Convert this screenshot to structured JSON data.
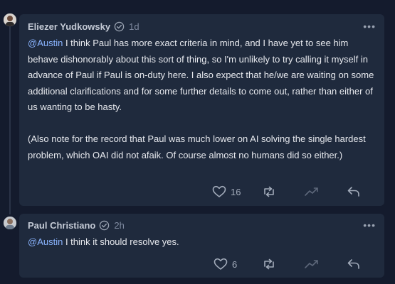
{
  "comments": [
    {
      "author": "Eliezer Yudkowsky",
      "time": "1d",
      "more": "•••",
      "mention": "@Austin",
      "paragraph1": " I think Paul has more exact criteria in mind, and I have yet to see him behave dishonorably about this sort of thing, so I'm unlikely to try calling it myself in advance of Paul if Paul is on-duty here.  I also expect that he/we are waiting on some additional clarifications and for some further details to come out, rather than either of us wanting to be hasty.",
      "paragraph2": "(Also note for the record that Paul was much lower on AI solving the single hardest problem, which OAI did not afaik.  Of course almost no humans did so either.)",
      "likes": "16",
      "icons": [
        "avatar",
        "verified-icon",
        "more-icon",
        "heart-icon",
        "repost-icon",
        "trend-icon",
        "reply-icon"
      ]
    },
    {
      "author": "Paul Christiano",
      "time": "2h",
      "more": "•••",
      "mention": "@Austin",
      "text": " I think it should resolve yes.",
      "likes": "6",
      "icons": [
        "avatar",
        "verified-icon",
        "more-icon",
        "heart-icon",
        "repost-icon",
        "trend-icon",
        "reply-icon"
      ]
    }
  ],
  "colors": {
    "background": "#141b2d",
    "card": "#1f2a3d",
    "mention": "#8ab4ff",
    "muted": "#7f8aa0"
  }
}
